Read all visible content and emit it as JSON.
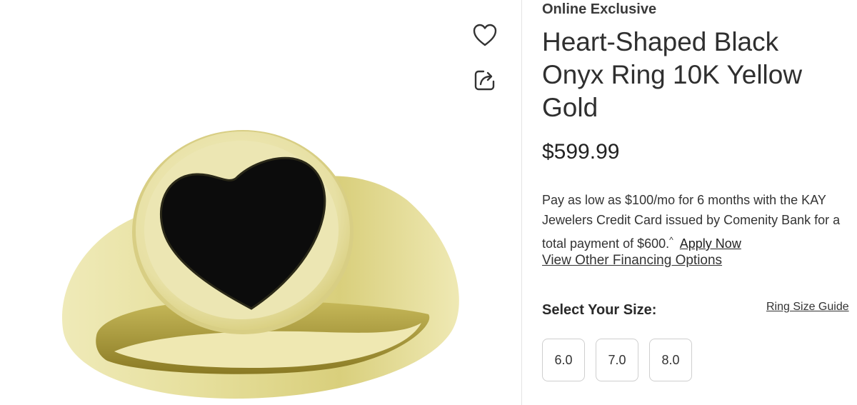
{
  "product": {
    "badge": "Online Exclusive",
    "title": "Heart-Shaped Black Onyx Ring 10K Yellow Gold",
    "price": "$599.99"
  },
  "financing": {
    "text": "Pay as low as $100/mo for 6 months with the KAY Jewelers Credit Card issued by Comenity Bank for a total payment of $600.",
    "footnote_mark": "^",
    "apply_label": "Apply Now",
    "other_options_label": "View Other Financing Options"
  },
  "size_selector": {
    "label": "Select Your Size:",
    "guide_label": "Ring Size Guide",
    "options": [
      "6.0",
      "7.0",
      "8.0"
    ]
  },
  "icons": {
    "wishlist": "heart-outline-icon",
    "share": "share-icon"
  },
  "colors": {
    "gold": "#e9e3a6",
    "onyx": "#0c0c0c",
    "border": "#cfcfcf"
  }
}
